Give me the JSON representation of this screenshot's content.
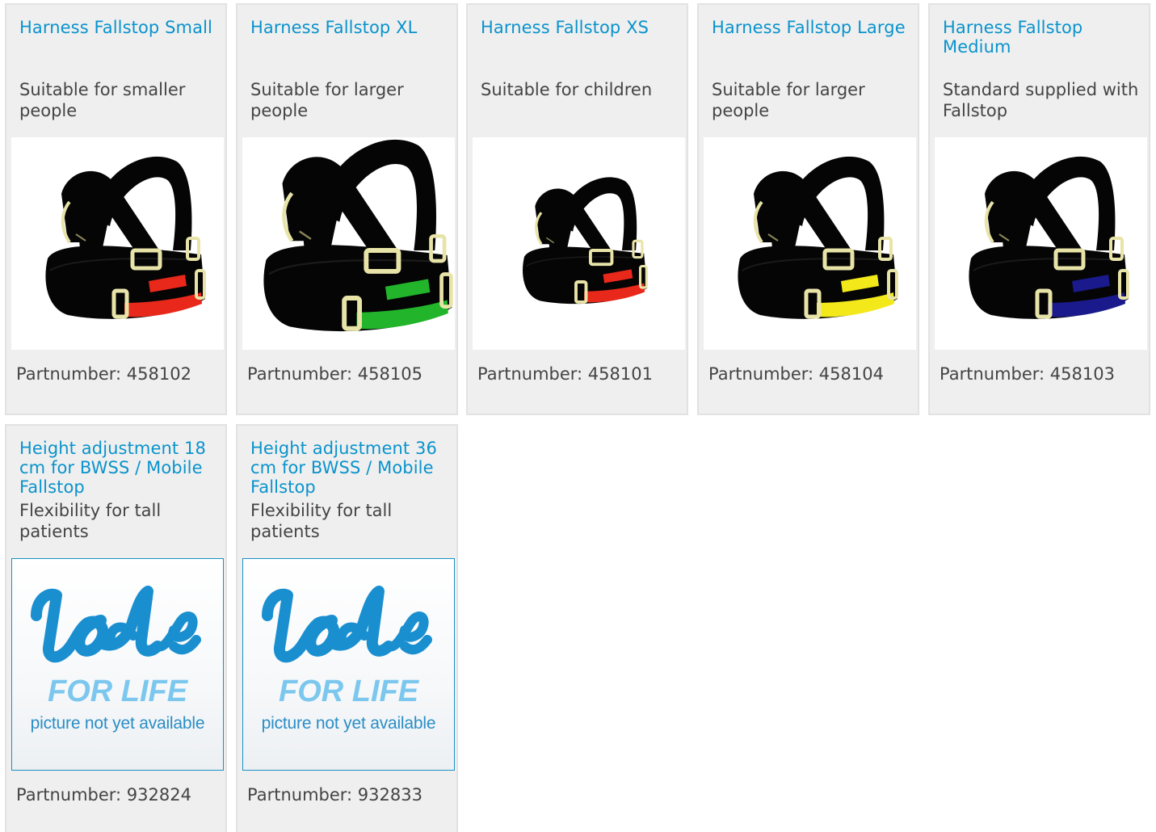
{
  "products": [
    {
      "title": "Harness Fallstop Small",
      "description": "Suitable for smaller people",
      "part_label": "Partnumber: 458102",
      "image_icon": "harness-image",
      "accent_color": "#e8281a"
    },
    {
      "title": "Harness Fallstop XL",
      "description": "Suitable for larger people",
      "part_label": "Partnumber: 458105",
      "image_icon": "harness-image",
      "accent_color": "#22b42a"
    },
    {
      "title": "Harness Fallstop XS",
      "description": "Suitable for children",
      "part_label": "Partnumber: 458101",
      "image_icon": "harness-image",
      "accent_color": "#e8281a"
    },
    {
      "title": "Harness Fallstop Large",
      "description": "Suitable for larger people",
      "part_label": "Partnumber: 458104",
      "image_icon": "harness-image",
      "accent_color": "#f2e81a"
    },
    {
      "title": "Harness Fallstop Medium",
      "description": "Standard supplied with Fallstop",
      "part_label": "Partnumber: 458103",
      "image_icon": "harness-image",
      "accent_color": "#1a1a8c"
    },
    {
      "title": "Height adjustment 18 cm for BWSS / Mobile Fallstop",
      "description": "Flexibility for tall patients",
      "part_label": "Partnumber: 932824",
      "image_icon": "lode-logo-placeholder",
      "placeholder_brand": "Lode",
      "placeholder_tagline": "FOR LIFE",
      "placeholder_text": "picture not yet available"
    },
    {
      "title": "Height adjustment 36 cm for BWSS / Mobile Fallstop",
      "description": "Flexibility for tall patients",
      "part_label": "Partnumber: 932833",
      "image_icon": "lode-logo-placeholder",
      "placeholder_brand": "Lode",
      "placeholder_tagline": "FOR LIFE",
      "placeholder_text": "picture not yet available"
    }
  ],
  "colors": {
    "title": "#0a93cc",
    "text": "#444444",
    "card_bg": "#efefef",
    "card_border": "#e2e2e2",
    "logo_blue": "#1a8fd0",
    "logo_light_blue": "#7cc7ee"
  }
}
